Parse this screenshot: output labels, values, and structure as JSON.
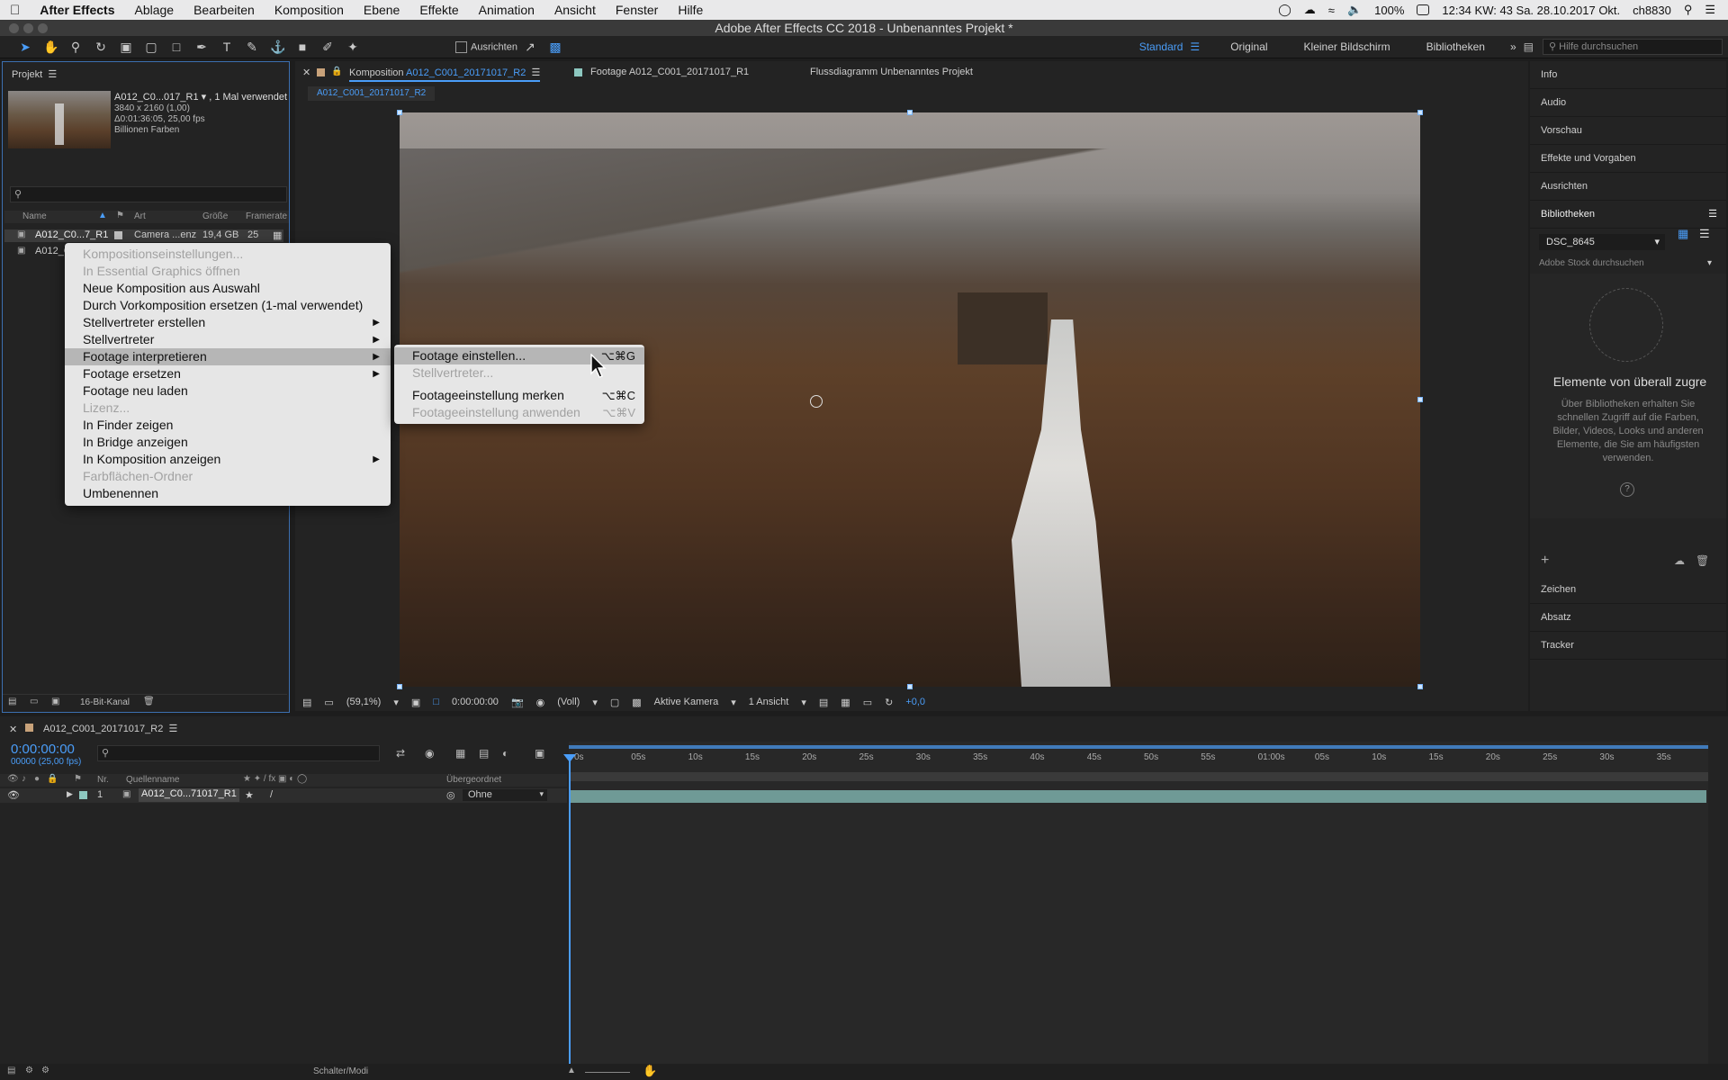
{
  "menubar": {
    "apple": "",
    "app_name": "After Effects",
    "items": [
      "Ablage",
      "Bearbeiten",
      "Komposition",
      "Ebene",
      "Effekte",
      "Animation",
      "Ansicht",
      "Fenster",
      "Hilfe"
    ],
    "battery": "100%",
    "clock": "12:34 KW: 43 Sa. 28.10.2017 Okt.",
    "user": "ch8830"
  },
  "window": {
    "title": "Adobe After Effects CC 2018 - Unbenanntes Projekt *"
  },
  "toolbar": {
    "ausrichten_label": "Ausrichten",
    "workspaces": [
      "Standard",
      "Original",
      "Kleiner Bildschirm",
      "Bibliotheken"
    ],
    "active_workspace": "Standard",
    "help_placeholder": "Hilfe durchsuchen"
  },
  "project": {
    "tab_label": "Projekt",
    "selected_name": "A012_C0...017_R1 ▾ , 1 Mal verwendet",
    "resolution": "3840 x 2160 (1,00)",
    "duration": "Δ0:01:36:05, 25,00 fps",
    "colors": "Billionen Farben",
    "search_placeholder": "",
    "columns": [
      "Name",
      "Art",
      "Größe",
      "Framerate"
    ],
    "rows": [
      {
        "name": "A012_C0...7_R1",
        "type": "Camera ...enz",
        "size": "19,4 GB",
        "fps": "25"
      },
      {
        "name": "A012_C",
        "type": "",
        "size": "",
        "fps": ""
      }
    ],
    "bit_depth": "16-Bit-Kanal"
  },
  "viewer": {
    "tabs": [
      {
        "label": "Komposition",
        "link": "A012_C001_20171017_R2"
      },
      {
        "label": "Footage A012_C001_20171017_R1"
      },
      {
        "label": "Flussdiagramm Unbenanntes Projekt"
      }
    ],
    "breadcrumb": "A012_C001_20171017_R2",
    "zoom": "(59,1%)",
    "timecode": "0:00:00:00",
    "resolution": "(Voll)",
    "camera": "Aktive Kamera",
    "views": "1 Ansicht",
    "exposure": "+0,0"
  },
  "context_menu": {
    "items": [
      {
        "label": "Kompositionseinstellungen...",
        "disabled": true
      },
      {
        "label": "In Essential Graphics öffnen",
        "disabled": true
      },
      {
        "label": "Neue Komposition aus Auswahl"
      },
      {
        "label": "Durch Vorkomposition ersetzen (1-mal verwendet)"
      },
      {
        "label": "Stellvertreter erstellen",
        "submenu": true
      },
      {
        "label": "Stellvertreter",
        "submenu": true
      },
      {
        "label": "Footage interpretieren",
        "submenu": true,
        "selected": true
      },
      {
        "label": "Footage ersetzen",
        "submenu": true
      },
      {
        "label": "Footage neu laden"
      },
      {
        "label": "Lizenz...",
        "disabled": true
      },
      {
        "label": "In Finder zeigen"
      },
      {
        "label": "In Bridge anzeigen"
      },
      {
        "label": "In Komposition anzeigen",
        "submenu": true
      },
      {
        "label": "Farbflächen-Ordner",
        "disabled": true
      },
      {
        "label": "Umbenennen"
      }
    ]
  },
  "submenu": {
    "items": [
      {
        "label": "Footage einstellen...",
        "shortcut": "⌥⌘G",
        "selected": true
      },
      {
        "label": "Stellvertreter...",
        "disabled": true
      },
      {
        "label": "Footageeinstellung merken",
        "shortcut": "⌥⌘C"
      },
      {
        "label": "Footageeinstellung anwenden",
        "shortcut": "⌥⌘V",
        "disabled": true
      }
    ]
  },
  "right_panel": {
    "items_top": [
      "Info",
      "Audio",
      "Vorschau",
      "Effekte und Vorgaben",
      "Ausrichten"
    ],
    "libraries_title": "Bibliotheken",
    "library_name": "DSC_8645",
    "stock_placeholder": "Adobe Stock durchsuchen",
    "promo_title": "Elemente von überall zugre",
    "promo_text": "Über Bibliotheken erhalten Sie schnellen Zugriff auf die Farben, Bilder, Videos, Looks und anderen Elemente, die Sie am häufigsten verwenden.",
    "items_bottom": [
      "Zeichen",
      "Absatz",
      "Tracker"
    ]
  },
  "timeline": {
    "comp_name": "A012_C001_20171017_R2",
    "timecode": "0:00:00:00",
    "frame_info": "00000 (25,00 fps)",
    "columns": {
      "nr": "Nr.",
      "source": "Quellenname",
      "parent": "Übergeordnet"
    },
    "layer": {
      "nr": "1",
      "name": "A012_C0...71017_R1",
      "parent": "Ohne"
    },
    "ruler": [
      "0s",
      "05s",
      "10s",
      "15s",
      "20s",
      "25s",
      "30s",
      "35s",
      "40s",
      "45s",
      "50s",
      "55s",
      "01:00s",
      "05s",
      "10s",
      "15s",
      "20s",
      "25s",
      "30s",
      "35s"
    ],
    "switch_label": "Schalter/Modi"
  }
}
